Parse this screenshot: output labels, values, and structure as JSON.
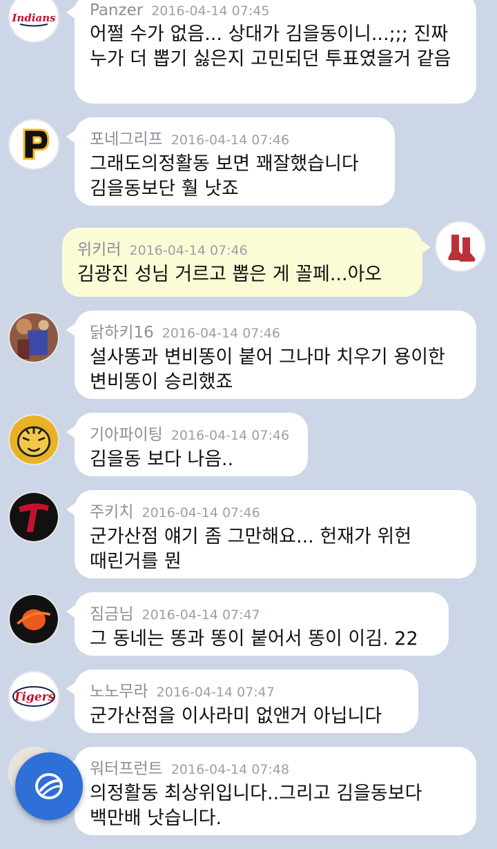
{
  "messages": [
    {
      "name": "Panzer",
      "time": "2016-04-14 07:45",
      "text": "어쩔 수가 없음... 상대가 김을동이니...;;; 진짜 누가 더 뽑기 싫은지 고민되던 투표였을거 같음",
      "avatar": "indians-logo-icon"
    },
    {
      "name": "포네그리프",
      "time": "2016-04-14 07:46",
      "text": "그래도의정활동 보면 꽤잘했습니다 김을동보단 훨 낫죠",
      "avatar": "pirates-logo-icon"
    },
    {
      "name": "위키러",
      "time": "2016-04-14 07:46",
      "text": "김광진 성님 거르고 뽑은 게 꼴페...아오",
      "avatar": "red-sox-logo-icon",
      "mine": true
    },
    {
      "name": "닭하키16",
      "time": "2016-04-14 07:46",
      "text": "설사똥과 변비똥이 붙어 그나마 치우기 용이한 변비똥이 승리했죠",
      "avatar": "basketball-photo-icon"
    },
    {
      "name": "기아파이팅",
      "time": "2016-04-14 07:46",
      "text": "김을동 보다 나음..",
      "avatar": "tiger-logo-icon"
    },
    {
      "name": "주키치",
      "time": "2016-04-14 07:46",
      "text": "군가산점 얘기 좀 그만해요... 헌재가 위헌 때린거를 뭔",
      "avatar": "twins-logo-icon"
    },
    {
      "name": "짐금님",
      "time": "2016-04-14 07:47",
      "text": "그 동네는 똥과 똥이 붙어서 똥이 이김. 22",
      "avatar": "orbit-logo-icon"
    },
    {
      "name": "노노무라",
      "time": "2016-04-14 07:47",
      "text": "군가산점을 이사라미 없앤거 아닙니다",
      "avatar": "tigers-logo-icon"
    },
    {
      "name": "워터프런트",
      "time": "2016-04-14 07:48",
      "text": "의정활동 최상위입니다..그리고 김을동보다 백만배 낫습니다.",
      "avatar": "portrait-icon"
    }
  ],
  "floating_button": {
    "icon": "site-logo-icon"
  },
  "colors": {
    "background": "#cdd6e6",
    "bubble": "#ffffff",
    "my_bubble": "#fbfcd6",
    "accent": "#2e6fd8"
  }
}
